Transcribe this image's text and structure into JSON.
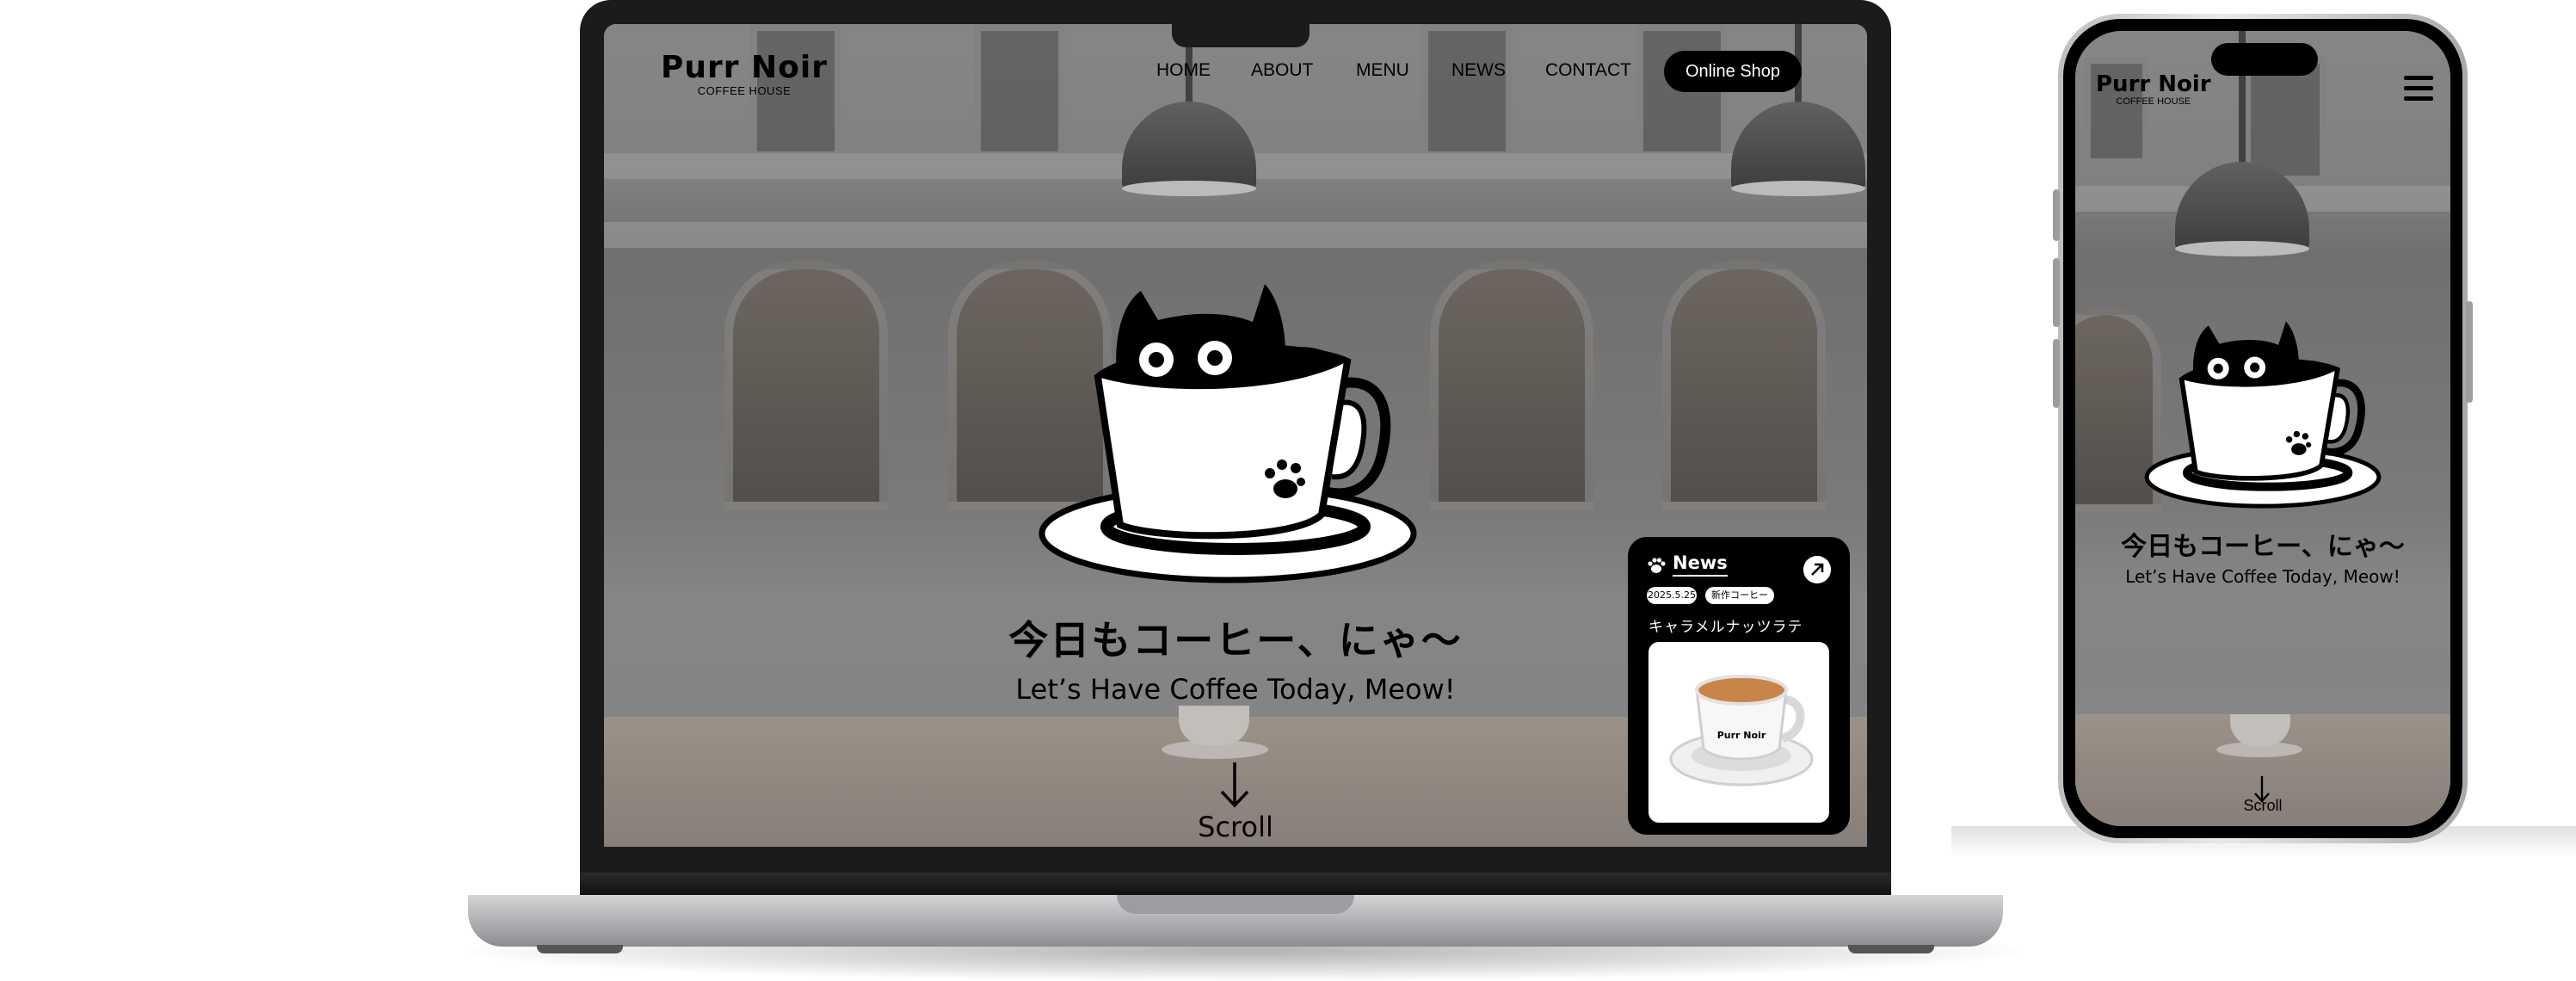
{
  "brand": {
    "name": "Purr Noir",
    "tagline": "COFFEE HOUSE"
  },
  "nav": {
    "items": [
      "HOME",
      "ABOUT",
      "MENU",
      "NEWS",
      "CONTACT"
    ],
    "cta": "Online Shop"
  },
  "hero": {
    "title_jp": "今日もコーヒー、にゃ〜",
    "subtitle": "Let’s Have Coffee Today, Meow!",
    "scroll_label": "Scroll"
  },
  "news": {
    "title": "News",
    "date": "2025.5.25",
    "category": "新作コーヒー",
    "headline": "キャラメルナッツラテ",
    "cup_brand": "Purr Noir"
  },
  "colors": {
    "ink": "#000000",
    "paper": "#ffffff",
    "overlay": "#7b7b7b"
  },
  "icons": [
    "paw-icon",
    "arrow-up-right-icon",
    "arrow-down-icon",
    "hamburger-menu-icon"
  ]
}
